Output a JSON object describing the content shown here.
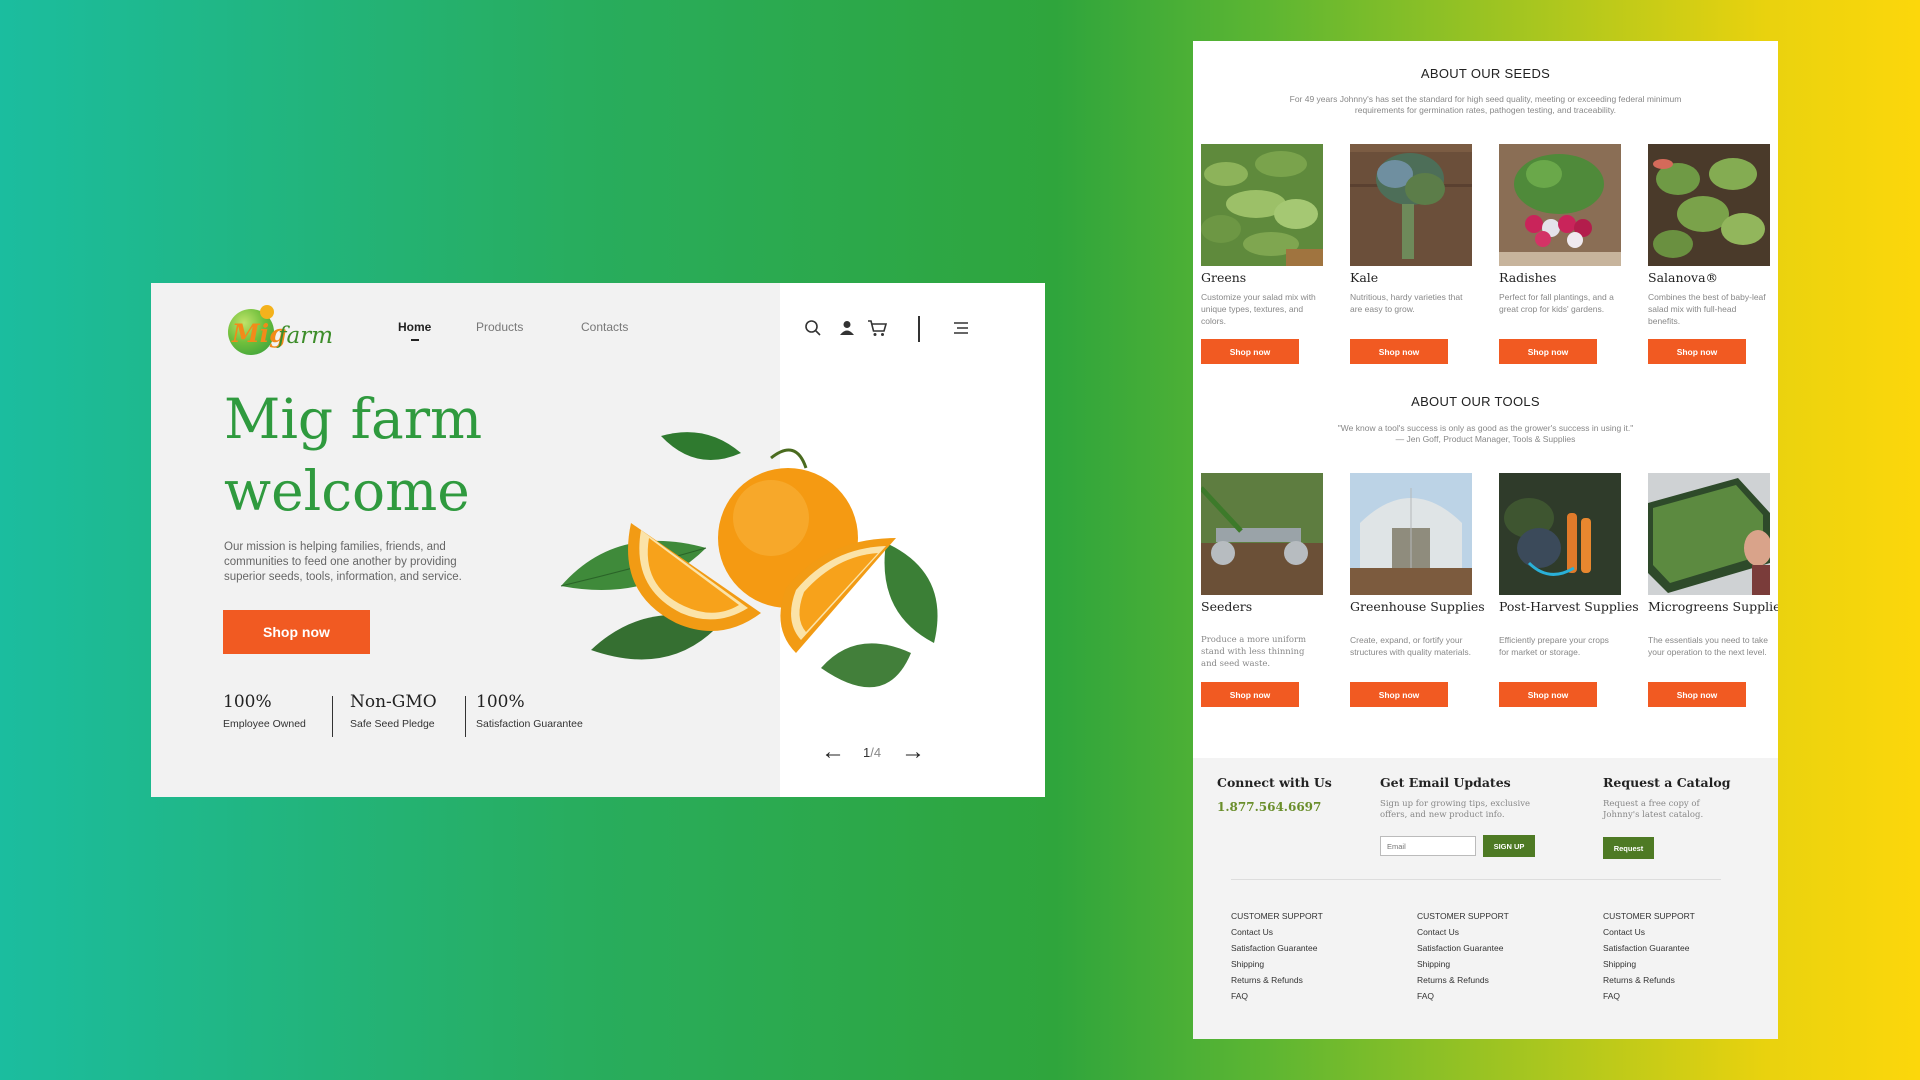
{
  "hero": {
    "logo": {
      "part1": "Mig",
      "part2": "farm"
    },
    "nav": [
      {
        "label": "Home",
        "active": true
      },
      {
        "label": "Products",
        "active": false
      },
      {
        "label": "Contacts",
        "active": false
      }
    ],
    "icons": [
      "search-icon",
      "user-icon",
      "cart-icon",
      "menu-icon"
    ],
    "title_line1": "Mig farm",
    "title_line2": "welcome",
    "description": "Our mission is helping families, friends, and communities to feed one another by providing superior seeds, tools, information, and service.",
    "shop_label": "Shop now",
    "stats": [
      {
        "value": "100%",
        "label": "Employee Owned"
      },
      {
        "value": "Non-GMO",
        "label": "Safe Seed Pledge"
      },
      {
        "value": "100%",
        "label": "Satisfaction Guarantee"
      }
    ],
    "pager": {
      "current": "1",
      "total": "4"
    },
    "colors": {
      "accent": "#f15a22",
      "title": "#2f9a3e",
      "card_bg": "#f2f2f2"
    }
  },
  "seeds": {
    "title": "ABOUT OUR SEEDS",
    "subtitle": "For 49 years Johnny's has set the standard for high seed quality, meeting or exceeding federal minimum requirements for germination rates, pathogen testing, and traceability.",
    "items": [
      {
        "name": "Greens",
        "desc": "Customize your salad mix with unique types, textures, and colors.",
        "cta": "Shop now"
      },
      {
        "name": "Kale",
        "desc": "Nutritious, hardy varieties that are easy to grow.",
        "cta": "Shop now"
      },
      {
        "name": "Radishes",
        "desc": "Perfect for fall plantings, and a great crop for kids' gardens.",
        "cta": "Shop now"
      },
      {
        "name": "Salanova®",
        "desc": "Combines the best of baby-leaf salad mix with full-head benefits.",
        "cta": "Shop now"
      }
    ]
  },
  "tools": {
    "title": "ABOUT OUR TOOLS",
    "quote": "\"We know a tool's success is only as good as the grower's success in using it.\"",
    "attribution": "— Jen Goff, Product Manager, Tools & Supplies",
    "items": [
      {
        "name": "Seeders",
        "desc": "Produce a more uniform stand with less thinning and seed waste.",
        "cta": "Shop now"
      },
      {
        "name": "Greenhouse Supplies",
        "desc": "Create, expand, or fortify your structures with quality materials.",
        "cta": "Shop now"
      },
      {
        "name": "Post-Harvest Supplies",
        "desc": "Efficiently prepare your crops for market or storage.",
        "cta": "Shop now"
      },
      {
        "name": "Microgreens Supplies",
        "desc": "The essentials you need to take your operation to the next level.",
        "cta": "Shop now"
      }
    ]
  },
  "footer": {
    "connect": {
      "title": "Connect with Us",
      "phone": "1.877.564.6697"
    },
    "email": {
      "title": "Get Email Updates",
      "text": "Sign up for growing tips, exclusive offers, and new product info.",
      "placeholder": "Email",
      "button": "SIGN UP"
    },
    "catalog": {
      "title": "Request a Catalog",
      "text": "Request a free copy of Johnny's latest catalog.",
      "button": "Request"
    },
    "columns": [
      {
        "heading": "CUSTOMER SUPPORT",
        "links": [
          "Contact Us",
          "Satisfaction Guarantee",
          "Shipping",
          "Returns & Refunds",
          "FAQ"
        ]
      },
      {
        "heading": "CUSTOMER SUPPORT",
        "links": [
          "Contact Us",
          "Satisfaction Guarantee",
          "Shipping",
          "Returns & Refunds",
          "FAQ"
        ]
      },
      {
        "heading": "CUSTOMER SUPPORT",
        "links": [
          "Contact Us",
          "Satisfaction Guarantee",
          "Shipping",
          "Returns & Refunds",
          "FAQ"
        ]
      }
    ],
    "colors": {
      "button_green": "#4e7a24",
      "phone_green": "#6a8e2b"
    }
  }
}
